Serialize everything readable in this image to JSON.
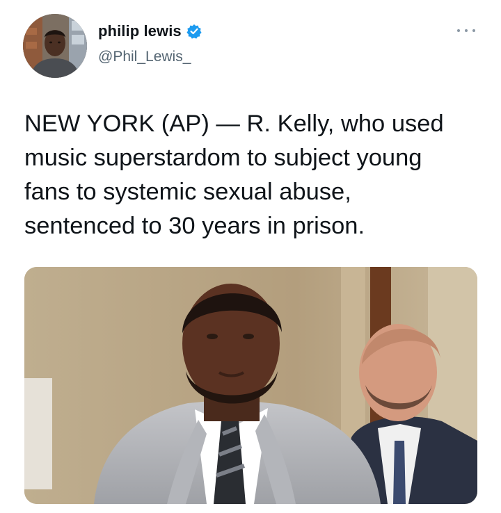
{
  "author": {
    "display_name": "philip lewis",
    "handle": "@Phil_Lewis_",
    "verified": true,
    "avatar_icon": "profile-photo"
  },
  "menu": {
    "icon": "more-options-icon"
  },
  "tweet": {
    "text": "NEW YORK (AP) — R. Kelly, who used\nmusic superstardom to subject young\nfans to systemic sexual abuse,\nsentenced to 30 years in prison."
  },
  "media": {
    "type": "photo"
  },
  "colors": {
    "verified": "#1d9bf0",
    "text": "#0f1419",
    "secondary": "#536471"
  }
}
